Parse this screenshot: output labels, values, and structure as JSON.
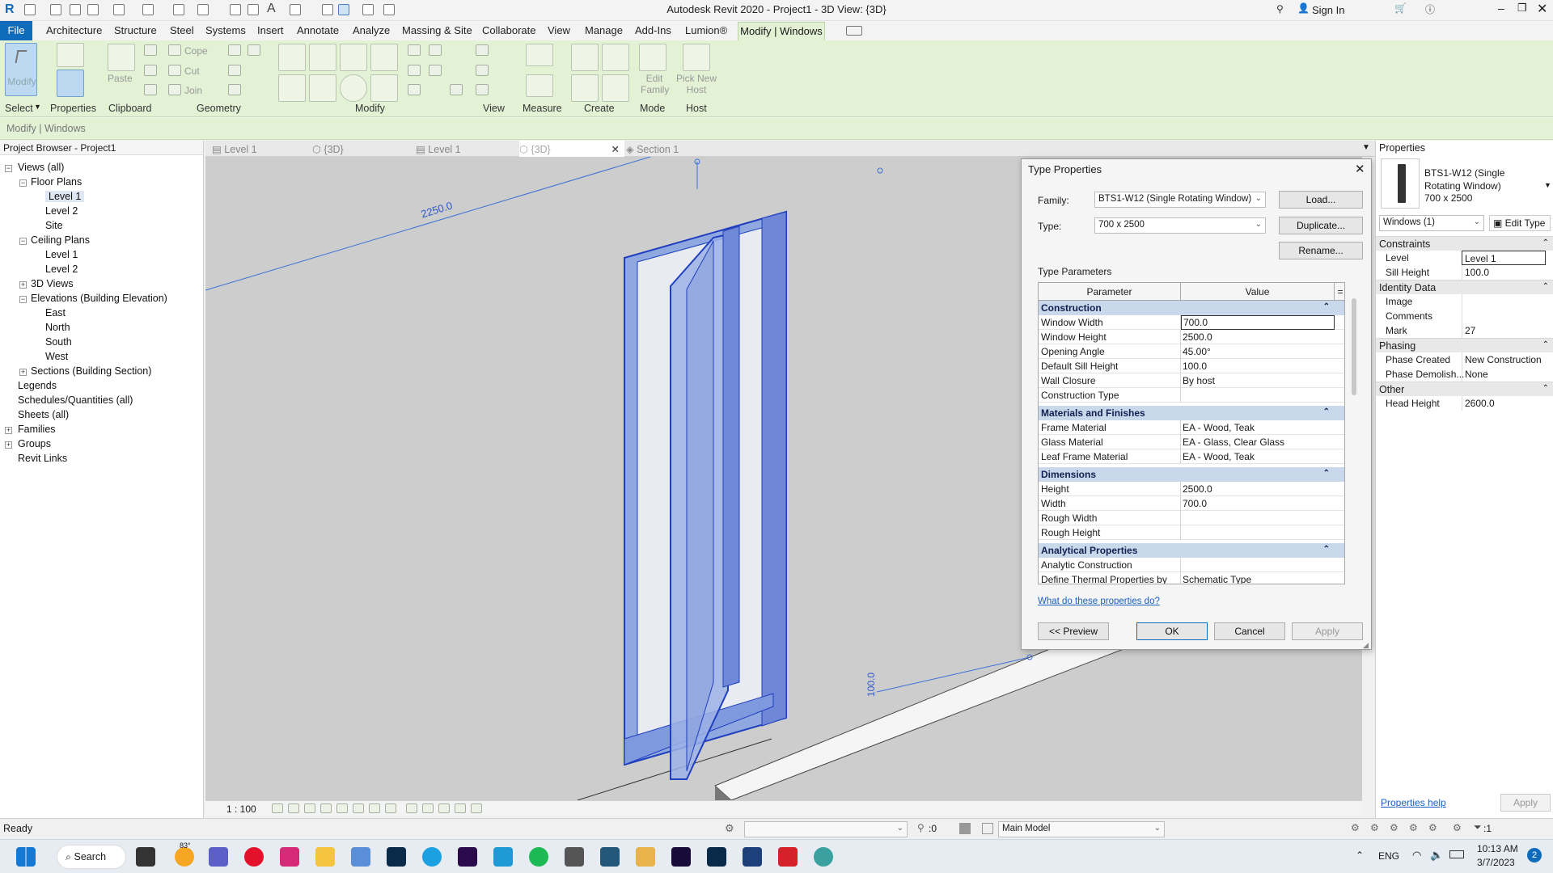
{
  "window": {
    "title": "Autodesk Revit 2020 - Project1 - 3D View: {3D}",
    "sign_in": "Sign In"
  },
  "menu": {
    "file": "File",
    "tabs": [
      "Architecture",
      "Structure",
      "Steel",
      "Systems",
      "Insert",
      "Annotate",
      "Analyze",
      "Massing & Site",
      "Collaborate",
      "View",
      "Manage",
      "Add-Ins",
      "Lumion®"
    ],
    "active_tab": "Modify | Windows"
  },
  "ribbon": {
    "modify_button": "Modify",
    "paste_button": "Paste",
    "cope": "Cope",
    "cut": "Cut",
    "join": "Join",
    "edit_family": "Edit Family",
    "pick_new_host": "Pick New Host",
    "panels": [
      "Select",
      "Properties",
      "Clipboard",
      "Geometry",
      "Modify",
      "View",
      "Measure",
      "Create",
      "Mode",
      "Host"
    ]
  },
  "context_bar": "Modify | Windows",
  "project_browser": {
    "title": "Project Browser - Project1",
    "items": [
      {
        "label": "Views (all)",
        "level": 0,
        "toggle": "−"
      },
      {
        "label": "Floor Plans",
        "level": 1,
        "toggle": "−"
      },
      {
        "label": "Level 1",
        "level": 2,
        "selected": true
      },
      {
        "label": "Level 2",
        "level": 2
      },
      {
        "label": "Site",
        "level": 2
      },
      {
        "label": "Ceiling Plans",
        "level": 1,
        "toggle": "−"
      },
      {
        "label": "Level 1",
        "level": 2
      },
      {
        "label": "Level 2",
        "level": 2
      },
      {
        "label": "3D Views",
        "level": 1,
        "toggle": "+"
      },
      {
        "label": "Elevations (Building Elevation)",
        "level": 1,
        "toggle": "−"
      },
      {
        "label": "East",
        "level": 2
      },
      {
        "label": "North",
        "level": 2
      },
      {
        "label": "South",
        "level": 2
      },
      {
        "label": "West",
        "level": 2
      },
      {
        "label": "Sections (Building Section)",
        "level": 1,
        "toggle": "+"
      },
      {
        "label": "Legends",
        "level": 0
      },
      {
        "label": "Schedules/Quantities (all)",
        "level": 0
      },
      {
        "label": "Sheets (all)",
        "level": 0
      },
      {
        "label": "Families",
        "level": 0,
        "toggle": "+"
      },
      {
        "label": "Groups",
        "level": 0,
        "toggle": "+"
      },
      {
        "label": "Revit Links",
        "level": 0
      }
    ]
  },
  "view_tabs": [
    "Level 1",
    "{3D}",
    "Level 1",
    "{3D}",
    "Section 1"
  ],
  "canvas": {
    "dim_top": "2250.0",
    "dim_bottom": "100.0"
  },
  "view_control": {
    "scale": "1 : 100"
  },
  "dialog": {
    "title": "Type Properties",
    "family_label": "Family:",
    "family_value": "BTS1-W12 (Single Rotating Window)",
    "type_label": "Type:",
    "type_value": "700 x 2500",
    "load": "Load...",
    "duplicate": "Duplicate...",
    "rename": "Rename...",
    "type_parameters": "Type Parameters",
    "col_parameter": "Parameter",
    "col_value": "Value",
    "groups": [
      {
        "name": "Construction",
        "rows": [
          {
            "p": "Window Width",
            "v": "700.0"
          },
          {
            "p": "Window Height",
            "v": "2500.0"
          },
          {
            "p": "Opening Angle",
            "v": "45.00°"
          },
          {
            "p": "Default Sill Height",
            "v": "100.0"
          },
          {
            "p": "Wall Closure",
            "v": "By host"
          },
          {
            "p": "Construction Type",
            "v": ""
          }
        ]
      },
      {
        "name": "Materials and Finishes",
        "rows": [
          {
            "p": "Frame Material",
            "v": "EA - Wood, Teak"
          },
          {
            "p": "Glass Material",
            "v": "EA - Glass, Clear Glass"
          },
          {
            "p": "Leaf Frame Material",
            "v": "EA - Wood, Teak"
          }
        ]
      },
      {
        "name": "Dimensions",
        "rows": [
          {
            "p": "Height",
            "v": "2500.0"
          },
          {
            "p": "Width",
            "v": "700.0"
          },
          {
            "p": "Rough Width",
            "v": ""
          },
          {
            "p": "Rough Height",
            "v": ""
          }
        ]
      },
      {
        "name": "Analytical Properties",
        "rows": [
          {
            "p": "Analytic Construction",
            "v": ""
          },
          {
            "p": "Define Thermal Properties by",
            "v": "Schematic Type"
          }
        ]
      }
    ],
    "help_link": "What do these properties do?",
    "preview": "<< Preview",
    "ok": "OK",
    "cancel": "Cancel",
    "apply": "Apply"
  },
  "properties": {
    "title": "Properties",
    "type_name": "BTS1-W12 (Single Rotating Window)",
    "type_size": "700 x 2500",
    "selector": "Windows (1)",
    "edit_type": "Edit Type",
    "sections": [
      {
        "name": "Constraints",
        "rows": [
          {
            "p": "Level",
            "v": "Level 1"
          },
          {
            "p": "Sill Height",
            "v": "100.0"
          }
        ]
      },
      {
        "name": "Identity Data",
        "rows": [
          {
            "p": "Image",
            "v": ""
          },
          {
            "p": "Comments",
            "v": ""
          },
          {
            "p": "Mark",
            "v": "27"
          }
        ]
      },
      {
        "name": "Phasing",
        "rows": [
          {
            "p": "Phase Created",
            "v": "New Construction"
          },
          {
            "p": "Phase Demolish...",
            "v": "None"
          }
        ]
      },
      {
        "name": "Other",
        "rows": [
          {
            "p": "Head Height",
            "v": "2600.0"
          }
        ]
      }
    ],
    "help": "Properties help",
    "apply": "Apply"
  },
  "status": {
    "ready": "Ready",
    "zero": ":0",
    "model": "Main Model",
    "filter": ":1"
  },
  "taskbar": {
    "search": "Search",
    "weather": "83°",
    "lang": "ENG",
    "time": "10:13 AM",
    "date": "3/7/2023",
    "notif": "2"
  }
}
